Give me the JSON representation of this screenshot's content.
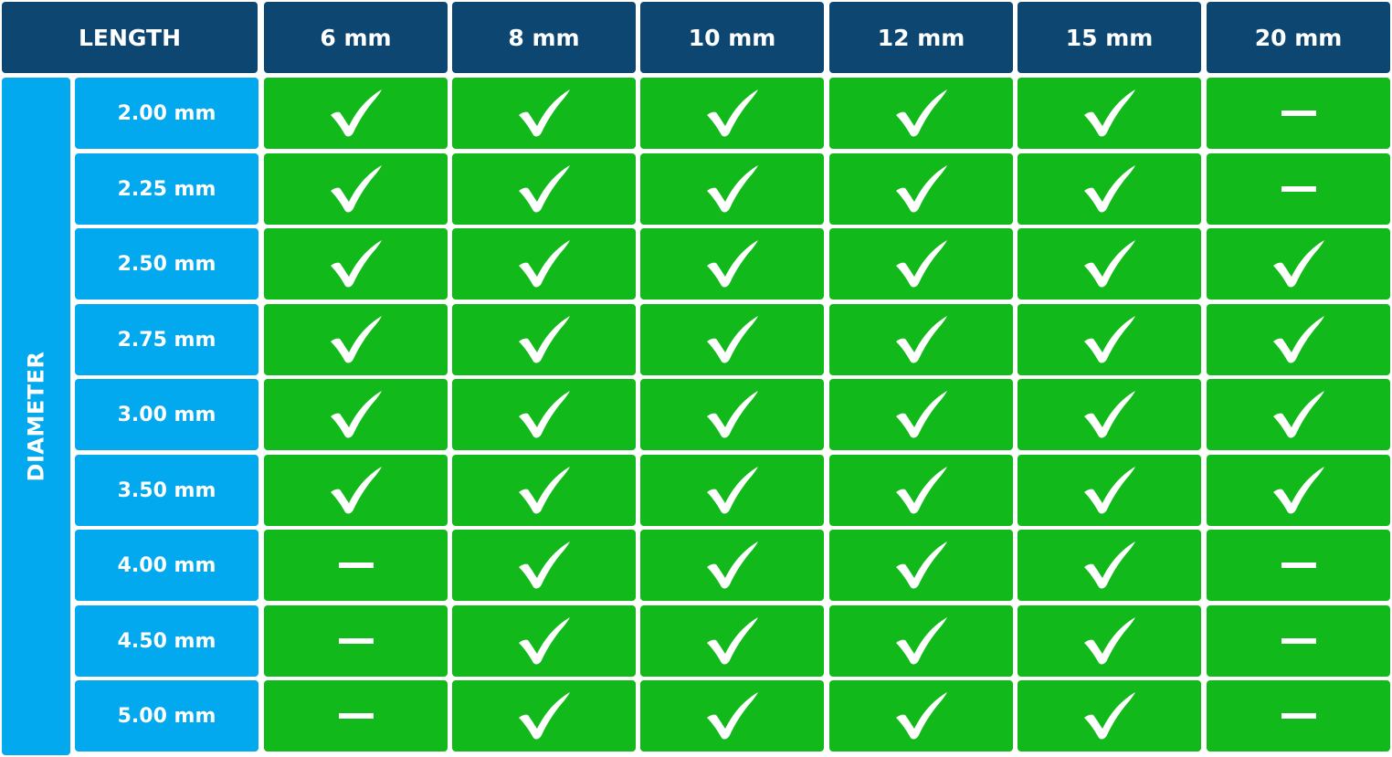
{
  "chart_data": {
    "type": "table",
    "header_label": "LENGTH",
    "row_axis_label": "DIAMETER",
    "columns": [
      "6 mm",
      "8 mm",
      "10 mm",
      "12 mm",
      "15 mm",
      "20 mm"
    ],
    "rows": [
      {
        "label": "2.00 mm",
        "values": [
          true,
          true,
          true,
          true,
          true,
          false
        ]
      },
      {
        "label": "2.25 mm",
        "values": [
          true,
          true,
          true,
          true,
          true,
          false
        ]
      },
      {
        "label": "2.50 mm",
        "values": [
          true,
          true,
          true,
          true,
          true,
          true
        ]
      },
      {
        "label": "2.75 mm",
        "values": [
          true,
          true,
          true,
          true,
          true,
          true
        ]
      },
      {
        "label": "3.00 mm",
        "values": [
          true,
          true,
          true,
          true,
          true,
          true
        ]
      },
      {
        "label": "3.50 mm",
        "values": [
          true,
          true,
          true,
          true,
          true,
          true
        ]
      },
      {
        "label": "4.00 mm",
        "values": [
          false,
          true,
          true,
          true,
          true,
          false
        ]
      },
      {
        "label": "4.50 mm",
        "values": [
          false,
          true,
          true,
          true,
          true,
          false
        ]
      },
      {
        "label": "5.00 mm",
        "values": [
          false,
          true,
          true,
          true,
          true,
          false
        ]
      }
    ],
    "legend": {
      "true": "check-icon",
      "false": "dash-icon"
    }
  },
  "colors": {
    "header_bg": "#0d4771",
    "row_header_bg": "#02a9ee",
    "cell_bg": "#12b91a",
    "mark": "#ffffff"
  }
}
